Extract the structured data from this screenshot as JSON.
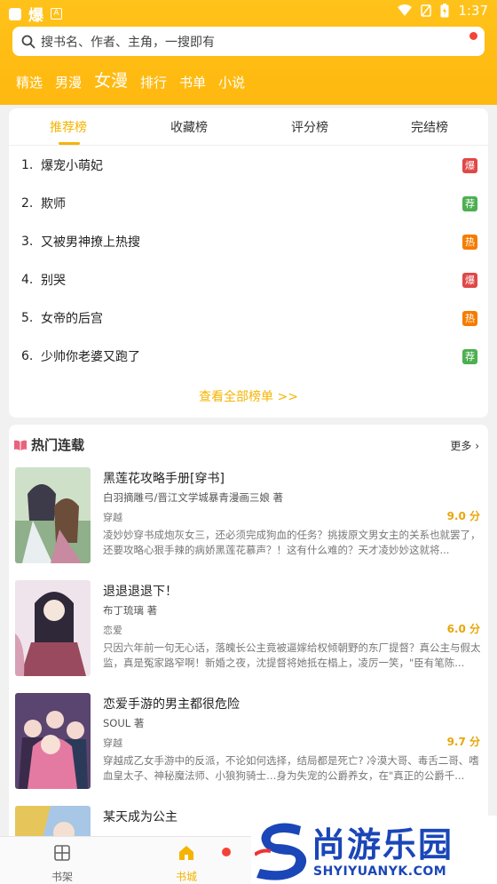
{
  "status_bar": {
    "app_glyph": "爆",
    "app_badge": "A",
    "time": "1:37"
  },
  "search": {
    "placeholder": "搜书名、作者、主角，一搜即有"
  },
  "nav": {
    "items": [
      {
        "label": "精选"
      },
      {
        "label": "男漫"
      },
      {
        "label": "女漫",
        "active": true
      },
      {
        "label": "排行"
      },
      {
        "label": "书单"
      },
      {
        "label": "小说"
      }
    ]
  },
  "rank": {
    "tabs": [
      {
        "label": "推荐榜",
        "active": true
      },
      {
        "label": "收藏榜"
      },
      {
        "label": "评分榜"
      },
      {
        "label": "完结榜"
      }
    ],
    "items": [
      {
        "num": "1.",
        "title": "爆宠小萌妃",
        "badge": "爆",
        "badge_color": "#e04848"
      },
      {
        "num": "2.",
        "title": "欺师",
        "badge": "荐",
        "badge_color": "#4caf50"
      },
      {
        "num": "3.",
        "title": "又被男神撩上热搜",
        "badge": "热",
        "badge_color": "#f57c00"
      },
      {
        "num": "4.",
        "title": "别哭",
        "badge": "爆",
        "badge_color": "#e04848"
      },
      {
        "num": "5.",
        "title": "女帝的后宫",
        "badge": "热",
        "badge_color": "#f57c00"
      },
      {
        "num": "6.",
        "title": "少帅你老婆又跑了",
        "badge": "荐",
        "badge_color": "#4caf50"
      }
    ],
    "view_all": "查看全部榜单 >>"
  },
  "hot": {
    "title": "热门连载",
    "more": "更多",
    "books": [
      {
        "title": "黑莲花攻略手册[穿书]",
        "author": "白羽摘雕弓/晋江文学城暴青漫画三娘 著",
        "genre": "穿越",
        "score": "9.0 分",
        "desc": "凌妙妙穿书成炮灰女三，还必须完成狗血的任务？挑拨原文男女主的关系也就罢了，还要攻略心狠手辣的病娇黑莲花慕声？！这有什么难的？天才凌妙妙这就将..."
      },
      {
        "title": "退退退退下！",
        "author": "布丁琉璃 著",
        "genre": "恋爱",
        "score": "6.0 分",
        "desc": "只因六年前一句无心话，落魄长公主竟被逼嫁给权倾朝野的东厂提督？真公主与假太监，真是冤家路窄啊！新婚之夜，沈提督将她抵在榻上，凌厉一笑，\"臣有笔陈..."
      },
      {
        "title": "恋爱手游的男主都很危险",
        "author": "SOUL 著",
        "genre": "穿越",
        "score": "9.7 分",
        "desc": "穿越成乙女手游中的反派，不论如何选择，结局都是死亡? 冷漠大哥、毒舌二哥、嗜血皇太子、神秘魔法师、小狼狗骑士…身为失宠的公爵养女，在\"真正的公爵千..."
      },
      {
        "title": "某天成为公主",
        "author": "",
        "genre": "",
        "score": "",
        "desc": ""
      }
    ]
  },
  "bottom_nav": {
    "items": [
      {
        "label": "书架"
      },
      {
        "label": "书城",
        "active": true
      }
    ]
  },
  "watermark": {
    "name": "尚游乐园",
    "url": "SHYIYUANYK.COM"
  },
  "colors": {
    "brand": "#ffbc16",
    "accent": "#f5b400",
    "hot_icon": "#e8647c"
  }
}
